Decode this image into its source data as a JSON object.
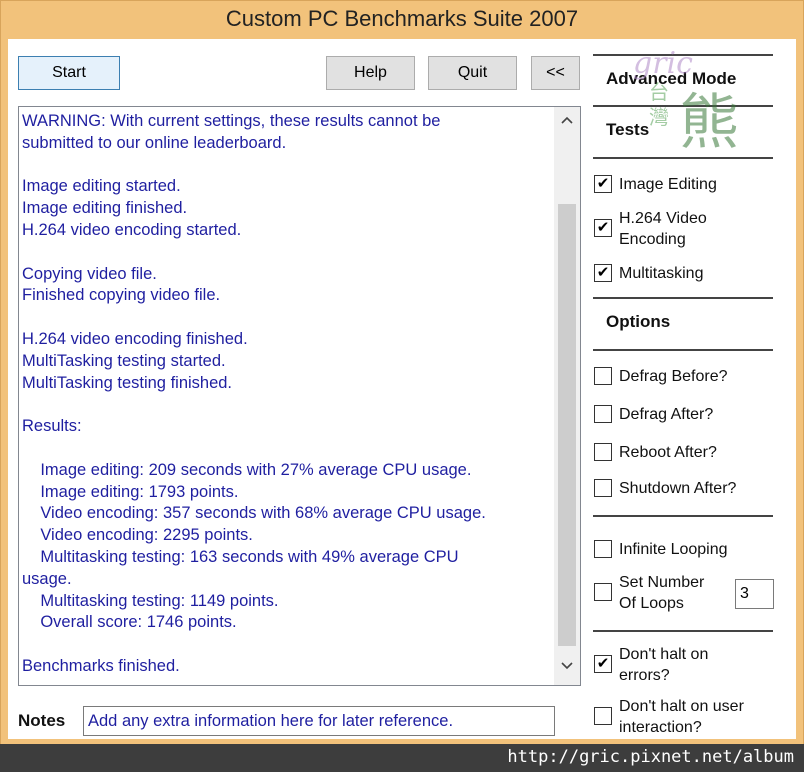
{
  "window": {
    "title": "Custom PC Benchmarks Suite 2007"
  },
  "toolbar": {
    "start_label": "Start",
    "help_label": "Help",
    "quit_label": "Quit",
    "collapse_label": "<<"
  },
  "log": {
    "text": "WARNING: With current settings, these results cannot be\nsubmitted to our online leaderboard.\n\nImage editing started.\nImage editing finished.\nH.264 video encoding started.\n\nCopying video file.\nFinished copying video file.\n\nH.264 video encoding finished.\nMultiTasking testing started.\nMultiTasking testing finished.\n\nResults:\n\n    Image editing: 209 seconds with 27% average CPU usage.\n    Image editing: 1793 points.\n    Video encoding: 357 seconds with 68% average CPU usage.\n    Video encoding: 2295 points.\n    Multitasking testing: 163 seconds with 49% average CPU\nusage.\n    Multitasking testing: 1149 points.\n    Overall score: 1746 points.\n\nBenchmarks finished.",
    "scroll_up_icon": "chevron-up-icon",
    "scroll_down_icon": "chevron-down-icon"
  },
  "notes": {
    "label": "Notes",
    "value": "Add any extra information here for later reference."
  },
  "side": {
    "advanced_mode": "Advanced Mode",
    "tests_title": "Tests",
    "tests": [
      {
        "label": "Image Editing",
        "checked": true
      },
      {
        "label": "H.264 Video Encoding",
        "checked": true
      },
      {
        "label": "Multitasking",
        "checked": true
      }
    ],
    "options_title": "Options",
    "options": [
      {
        "label": "Defrag Before?",
        "checked": false
      },
      {
        "label": "Defrag After?",
        "checked": false
      },
      {
        "label": "Reboot After?",
        "checked": false
      },
      {
        "label": "Shutdown After?",
        "checked": false
      }
    ],
    "infinite_looping": {
      "label": "Infinite Looping",
      "checked": false
    },
    "set_loops": {
      "label": "Set Number Of Loops",
      "checked": false,
      "value": "3"
    },
    "dont_halt_errors": {
      "label": "Don't halt on errors?",
      "checked": true
    },
    "dont_halt_interaction": {
      "label": "Don't halt on user interaction?",
      "checked": false
    }
  },
  "watermark": {
    "line1": "gric",
    "tw1": "台",
    "tw2": "灣",
    "bear": "熊"
  },
  "footer": {
    "url": "http://gric.pixnet.net/album"
  },
  "colors": {
    "frame": "#f2c27b",
    "log_text": "#1f1fa0",
    "accent_button_border": "#3c7fb1"
  }
}
